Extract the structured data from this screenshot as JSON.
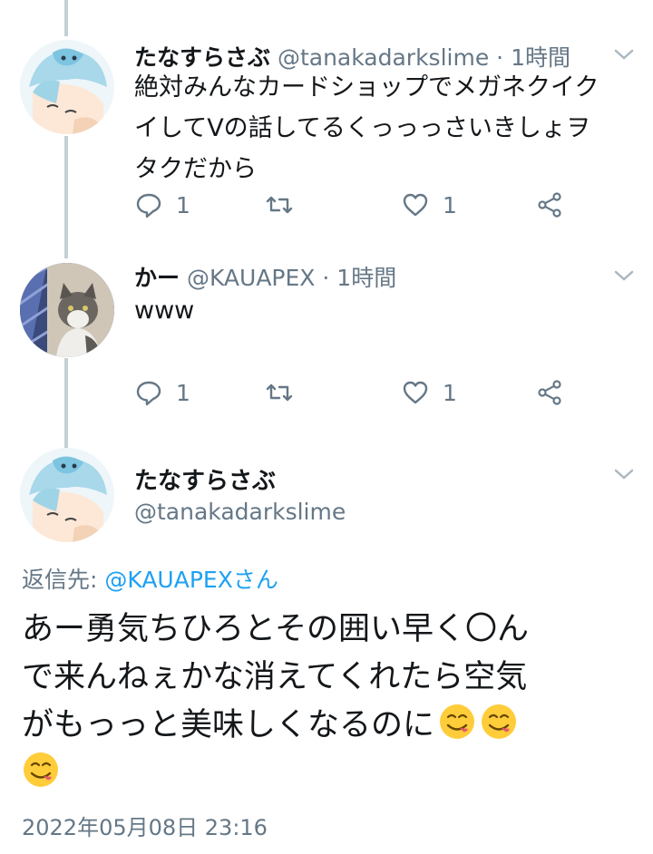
{
  "tweets": [
    {
      "name": "たなすらさぶ",
      "handle": "@tanakadarkslime",
      "time": "· 1時間",
      "lines": [
        "絶対みんなカードショップでメガネクイク",
        "イしてVの話してるくっっっさいきしょヲ",
        "タクだから"
      ],
      "replies": "1",
      "likes": "1"
    },
    {
      "name": "かー",
      "handle": "@KAUAPEX",
      "time": "· 1時間",
      "lines": [
        "www"
      ],
      "replies": "1",
      "likes": "1"
    }
  ],
  "main": {
    "name": "たなすらさぶ",
    "handle": "@tanakadarkslime",
    "reply_prefix": "返信先: ",
    "reply_link": "@KAUAPEXさん",
    "lines": [
      "あー勇気ちひろとその囲い早く〇ん",
      "で来んねぇかな消えてくれたら空気",
      "がもっっと美味しくなるのに"
    ],
    "emoji_name": "savoring-food-emoji",
    "timestamp": "2022年05月08日 23:16"
  },
  "colors": {
    "accent": "#1da1f2",
    "muted": "#657786",
    "thread_line": "#c4cfd6"
  }
}
